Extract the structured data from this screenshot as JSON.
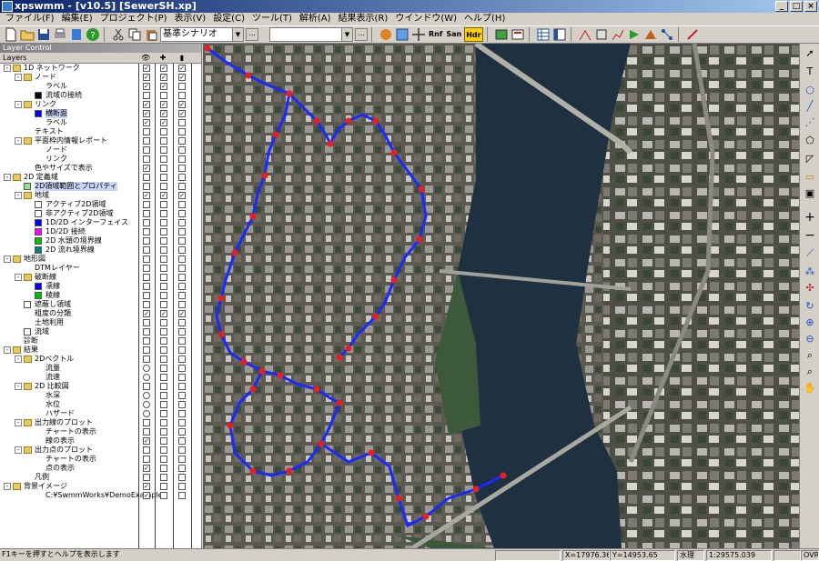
{
  "window": {
    "title": "xpswmm - [v10.5] [SewerSH.xp]"
  },
  "menu": [
    "ファイル(F)",
    "編集(E)",
    "プロジェクト(P)",
    "表示(V)",
    "設定(C)",
    "ツール(T)",
    "解析(A)",
    "結果表示(R)",
    "ウインドウ(W)",
    "ヘルプ(H)"
  ],
  "toolbar": {
    "scenario_value": "基準シナリオ",
    "second_combo_value": "",
    "text_buttons": [
      "Rnf",
      "San",
      "Hdr"
    ]
  },
  "layer_panel": {
    "title": "Layer Control",
    "column_header": "Layers",
    "rows": [
      {
        "level": 0,
        "label": "1D ネットワーク",
        "exp": "-",
        "folder": true,
        "c1": "x",
        "c2": "x",
        "c3": "x"
      },
      {
        "level": 1,
        "label": "ノード",
        "exp": "-",
        "folder": true,
        "c1": "x",
        "c2": "x",
        "c3": "x"
      },
      {
        "level": 2,
        "label": "ラベル",
        "c1": "x",
        "c2": "x",
        "c3": ""
      },
      {
        "level": 2,
        "label": "流域の接続",
        "swatch": "#000000",
        "c1": "",
        "c2": "",
        "c3": ""
      },
      {
        "level": 1,
        "label": "リンク",
        "exp": "-",
        "folder": true,
        "c1": "x",
        "c2": "x",
        "c3": "x"
      },
      {
        "level": 2,
        "label": "横断面",
        "swatch": "#0000ff",
        "c1": "x",
        "c2": "x",
        "c3": "x"
      },
      {
        "level": 2,
        "label": "ラベル",
        "c1": "x",
        "c2": "x",
        "c3": ""
      },
      {
        "level": 1,
        "label": "テキスト",
        "c1": "",
        "c2": "",
        "c3": ""
      },
      {
        "level": 1,
        "label": "平面枠内情報レポート",
        "exp": "-",
        "folder": true,
        "c1": "",
        "c2": "",
        "c3": ""
      },
      {
        "level": 2,
        "label": "ノード",
        "c1": "",
        "c2": "",
        "c3": ""
      },
      {
        "level": 2,
        "label": "リンク",
        "c1": "",
        "c2": "",
        "c3": ""
      },
      {
        "level": 1,
        "label": "色やサイズで表示",
        "c1": "x",
        "c2": "",
        "c3": ""
      },
      {
        "level": 0,
        "label": "2D 定義域",
        "exp": "-",
        "folder": true,
        "c1": "",
        "c2": "",
        "c3": ""
      },
      {
        "level": 1,
        "label": "2D領域範囲とプロパティ",
        "swatch": "#90e090",
        "c1": "",
        "c2": "",
        "c3": ""
      },
      {
        "level": 1,
        "label": "地域",
        "exp": "-",
        "folder": true,
        "c1": "x",
        "c2": "x",
        "c3": "x"
      },
      {
        "level": 2,
        "label": "アクティブ2D領域",
        "swatch": "#ffffff",
        "c1": "",
        "c2": "",
        "c3": ""
      },
      {
        "level": 2,
        "label": "非アクティブ2D領域",
        "swatch": "#ffffff",
        "c1": "",
        "c2": "",
        "c3": ""
      },
      {
        "level": 2,
        "label": "1D/2D インターフェイス",
        "swatch": "#0000ff",
        "c1": "",
        "c2": "",
        "c3": ""
      },
      {
        "level": 2,
        "label": "1D/2D 接続",
        "swatch": "#ff00ff",
        "c1": "",
        "c2": "",
        "c3": ""
      },
      {
        "level": 2,
        "label": "2D 水頭の境界線",
        "swatch": "#00c000",
        "c1": "",
        "c2": "",
        "c3": ""
      },
      {
        "level": 2,
        "label": "2D 流れ境界線",
        "swatch": "#008080",
        "c1": "",
        "c2": "",
        "c3": ""
      },
      {
        "level": 0,
        "label": "地形図",
        "exp": "-",
        "folder": true,
        "c1": "",
        "c2": "",
        "c3": ""
      },
      {
        "level": 1,
        "label": "DTMレイヤー",
        "c1": "",
        "c2": "",
        "c3": ""
      },
      {
        "level": 1,
        "label": "破断線",
        "exp": "-",
        "folder": true,
        "c1": "",
        "c2": "",
        "c3": ""
      },
      {
        "level": 2,
        "label": "凛線",
        "swatch": "#0000ff",
        "c1": "",
        "c2": "",
        "c3": ""
      },
      {
        "level": 2,
        "label": "稜線",
        "swatch": "#00c000",
        "c1": "",
        "c2": "",
        "c3": ""
      },
      {
        "level": 1,
        "label": "遮蔽し領域",
        "swatch": "#ffffff",
        "c1": "",
        "c2": "",
        "c3": ""
      },
      {
        "level": 1,
        "label": "粗度の分類",
        "c1": "x",
        "c2": "x",
        "c3": "x"
      },
      {
        "level": 1,
        "label": "土地利用",
        "c1": "",
        "c2": "",
        "c3": ""
      },
      {
        "level": 1,
        "label": "流域",
        "swatch": "#ffffff",
        "c1": "",
        "c2": "",
        "c3": ""
      },
      {
        "level": 0,
        "label": "診断",
        "c1": "",
        "c2": "",
        "c3": ""
      },
      {
        "level": 0,
        "label": "結果",
        "exp": "-",
        "folder": true,
        "c1": "",
        "c2": "",
        "c3": ""
      },
      {
        "level": 1,
        "label": "2Dベクトル",
        "exp": "-",
        "folder": true,
        "c1": "",
        "c2": "",
        "c3": ""
      },
      {
        "level": 2,
        "label": "流量",
        "c1": "o",
        "c2": "",
        "c3": ""
      },
      {
        "level": 2,
        "label": "流速",
        "c1": "o",
        "c2": "",
        "c3": ""
      },
      {
        "level": 1,
        "label": "2D 比較図",
        "exp": "-",
        "folder": true,
        "c1": "",
        "c2": "",
        "c3": ""
      },
      {
        "level": 2,
        "label": "水深",
        "c1": "o",
        "c2": "",
        "c3": ""
      },
      {
        "level": 2,
        "label": "水位",
        "c1": "o",
        "c2": "",
        "c3": ""
      },
      {
        "level": 2,
        "label": "ハザード",
        "c1": "o",
        "c2": "",
        "c3": ""
      },
      {
        "level": 1,
        "label": "出力線のプロット",
        "exp": "-",
        "folder": true,
        "c1": "",
        "c2": "",
        "c3": ""
      },
      {
        "level": 2,
        "label": "チャートの表示",
        "c1": "",
        "c2": "",
        "c3": ""
      },
      {
        "level": 2,
        "label": "線の表示",
        "c1": "x",
        "c2": "",
        "c3": ""
      },
      {
        "level": 1,
        "label": "出力点のプロット",
        "exp": "-",
        "folder": true,
        "c1": "",
        "c2": "",
        "c3": ""
      },
      {
        "level": 2,
        "label": "チャートの表示",
        "c1": "",
        "c2": "",
        "c3": ""
      },
      {
        "level": 2,
        "label": "点の表示",
        "c1": "x",
        "c2": "",
        "c3": ""
      },
      {
        "level": 1,
        "label": "凡例",
        "c1": "",
        "c2": "",
        "c3": ""
      },
      {
        "level": 0,
        "label": "背景イメージ",
        "exp": "-",
        "folder": true,
        "c1": "x",
        "c2": "",
        "c3": ""
      },
      {
        "level": 2,
        "label": "C:¥SwmmWorks¥DemoExample¥",
        "c1": "x",
        "c2": "",
        "c3": ""
      }
    ]
  },
  "statusbar": {
    "help": "F1キーを押すとヘルプを表示します",
    "x": "X=17976.36",
    "y": "Y=14953.65",
    "mode": "水理",
    "scale": "1:29575.039",
    "ovr": "OVR"
  },
  "colors": {
    "node": "#e52020",
    "link": "#1a2aff",
    "label": "#e02020",
    "river": "#1f3040"
  }
}
